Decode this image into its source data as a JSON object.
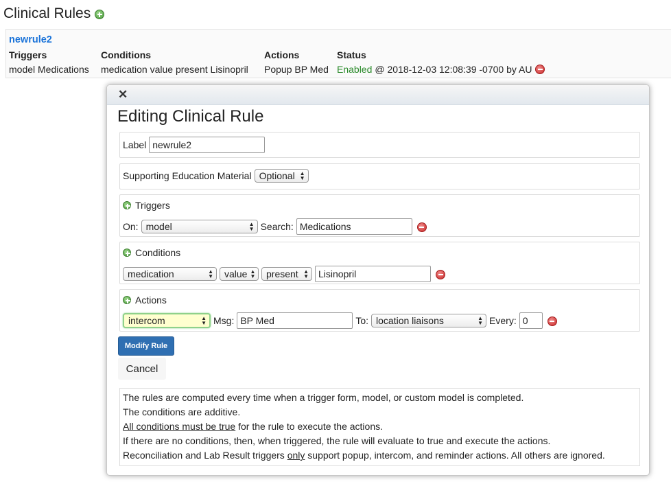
{
  "page": {
    "title": "Clinical Rules",
    "add_icon": "plus-circle-icon"
  },
  "summary": {
    "rule_name": "newrule2",
    "headers": [
      "Triggers",
      "Conditions",
      "Actions",
      "Status"
    ],
    "triggers": "model Medications",
    "conditions": "medication value present Lisinopril",
    "actions": "Popup BP Med",
    "status_word": "Enabled",
    "status_rest": "@ 2018-12-03 12:08:39 -0700 by AU",
    "remove_icon": "minus-circle-icon"
  },
  "modal": {
    "close_glyph": "✕",
    "title": "Editing Clinical Rule",
    "label_caption": "Label",
    "label_value": "newrule2",
    "sem_caption": "Supporting Education Material",
    "sem_value": "Optional",
    "triggers": {
      "heading": "Triggers",
      "on_caption": "On:",
      "on_value": "model",
      "search_caption": "Search:",
      "search_value": "Medications"
    },
    "conditions": {
      "heading": "Conditions",
      "field": "medication",
      "attribute": "value",
      "operator": "present",
      "value": "Lisinopril"
    },
    "actions": {
      "heading": "Actions",
      "type": "intercom",
      "msg_caption": "Msg:",
      "msg_value": "BP Med",
      "to_caption": "To:",
      "to_value": "location liaisons",
      "every_caption": "Every:",
      "every_value": "0"
    },
    "modify_button": "Modify Rule",
    "cancel_button": "Cancel",
    "info": {
      "line1": "The rules are computed every time when a trigger form, model, or custom model is completed.",
      "line2": "The conditions are additive.",
      "line3_underlined": "All conditions must be true",
      "line3_rest": " for the rule to execute the actions.",
      "line4": "If there are no conditions, then, when triggered, the rule will evaluate to true and execute the actions.",
      "line5_pre": "Reconciliation and Lab Result triggers ",
      "line5_underlined": "only",
      "line5_post": " support popup, intercom, and reminder actions. All others are ignored."
    }
  },
  "colors": {
    "link": "#1a73d9",
    "enabled": "#2a8a2a",
    "primary_button": "#2f6fb2",
    "add_icon": "#4a9a3a",
    "remove_icon": "#c92727"
  }
}
